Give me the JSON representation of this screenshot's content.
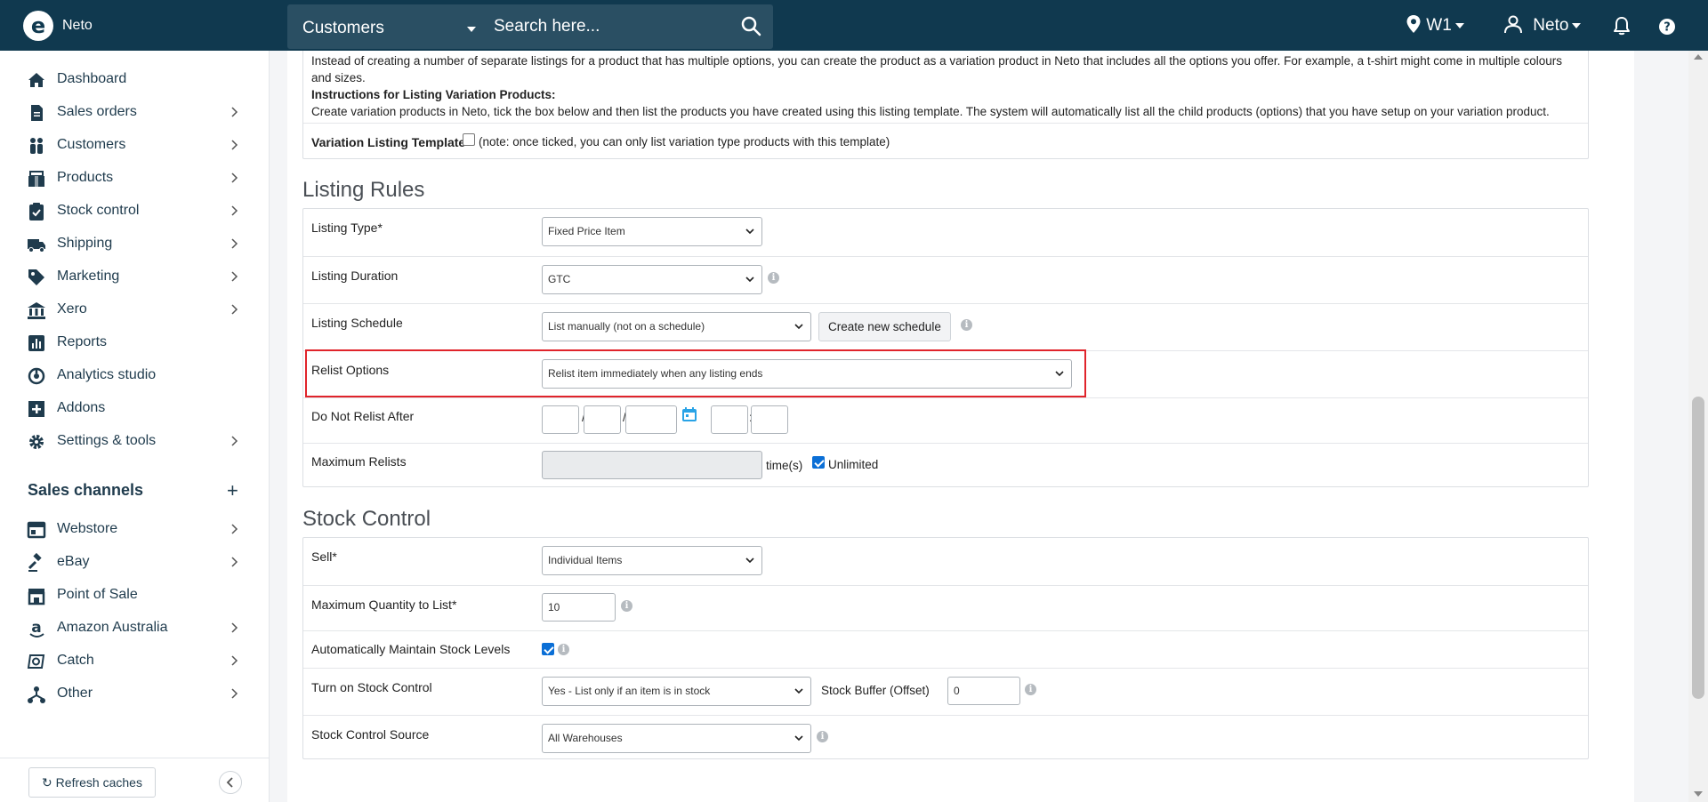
{
  "topbar": {
    "brand": "Neto",
    "search_category": "Customers",
    "search_placeholder": "Search here...",
    "location": "W1",
    "user": "Neto"
  },
  "sidebar": {
    "items": [
      {
        "label": "Dashboard",
        "icon": "home-icon",
        "chevron": false
      },
      {
        "label": "Sales orders",
        "icon": "document-icon",
        "chevron": true
      },
      {
        "label": "Customers",
        "icon": "people-icon",
        "chevron": true
      },
      {
        "label": "Products",
        "icon": "package-icon",
        "chevron": true
      },
      {
        "label": "Stock control",
        "icon": "clipboard-check-icon",
        "chevron": true
      },
      {
        "label": "Shipping",
        "icon": "truck-icon",
        "chevron": true
      },
      {
        "label": "Marketing",
        "icon": "tag-icon",
        "chevron": true
      },
      {
        "label": "Xero",
        "icon": "bank-icon",
        "chevron": true
      },
      {
        "label": "Reports",
        "icon": "bar-chart-icon",
        "chevron": false
      },
      {
        "label": "Analytics studio",
        "icon": "analytics-icon",
        "chevron": false
      },
      {
        "label": "Addons",
        "icon": "plus-square-icon",
        "chevron": false
      },
      {
        "label": "Settings & tools",
        "icon": "gear-icon",
        "chevron": true
      }
    ],
    "sales_channels_title": "Sales channels",
    "channels": [
      {
        "label": "Webstore",
        "icon": "browser-icon",
        "chevron": true
      },
      {
        "label": "eBay",
        "icon": "gavel-icon",
        "chevron": true
      },
      {
        "label": "Point of Sale",
        "icon": "store-icon",
        "chevron": false
      },
      {
        "label": "Amazon Australia",
        "icon": "amazon-icon",
        "chevron": true
      },
      {
        "label": "Catch",
        "icon": "catch-icon",
        "chevron": true
      },
      {
        "label": "Other",
        "icon": "network-icon",
        "chevron": true
      }
    ],
    "refresh_label": "Refresh caches"
  },
  "intro": {
    "line1": "Instead of creating a number of separate listings for a product that has multiple options, you can create the product as a variation product in Neto that includes all the options you offer. For example, a t-shirt might come in multiple colours",
    "line2": "and sizes.",
    "instructions_title": "Instructions for Listing Variation Products:",
    "instructions_text": "Create variation products in Neto, tick the box below and then list the products you have created using this listing template. The system will automatically list all the child products (options) that you have setup on your variation product.",
    "variation_label": "Variation Listing Template",
    "variation_note": "(note: once ticked, you can only list variation type products with this template)"
  },
  "listing_rules": {
    "heading": "Listing Rules",
    "listing_type_label": "Listing Type*",
    "listing_type_value": "Fixed Price Item",
    "duration_label": "Listing Duration",
    "duration_value": "GTC",
    "schedule_label": "Listing Schedule",
    "schedule_value": "List manually (not on a schedule)",
    "create_schedule_button": "Create new schedule",
    "relist_label": "Relist Options",
    "relist_value": "Relist item immediately when any listing ends",
    "no_relist_label": "Do Not Relist After",
    "date_sep": "/",
    "time_sep": ":",
    "max_relists_label": "Maximum Relists",
    "times_suffix": "time(s)",
    "unlimited_label": "Unlimited"
  },
  "stock_control": {
    "heading": "Stock Control",
    "sell_label": "Sell*",
    "sell_value": "Individual Items",
    "max_qty_label": "Maximum Quantity to List*",
    "max_qty_value": "10",
    "auto_maintain_label": "Automatically Maintain Stock Levels",
    "turn_on_label": "Turn on Stock Control",
    "turn_on_value": "Yes - List only if an item is in stock",
    "buffer_label": "Stock Buffer (Offset)",
    "buffer_value": "0",
    "source_label": "Stock Control Source",
    "source_value": "All Warehouses"
  },
  "colors": {
    "topbar": "#10394f",
    "highlight": "#e0242b",
    "checkbox": "#0b6fd6"
  }
}
